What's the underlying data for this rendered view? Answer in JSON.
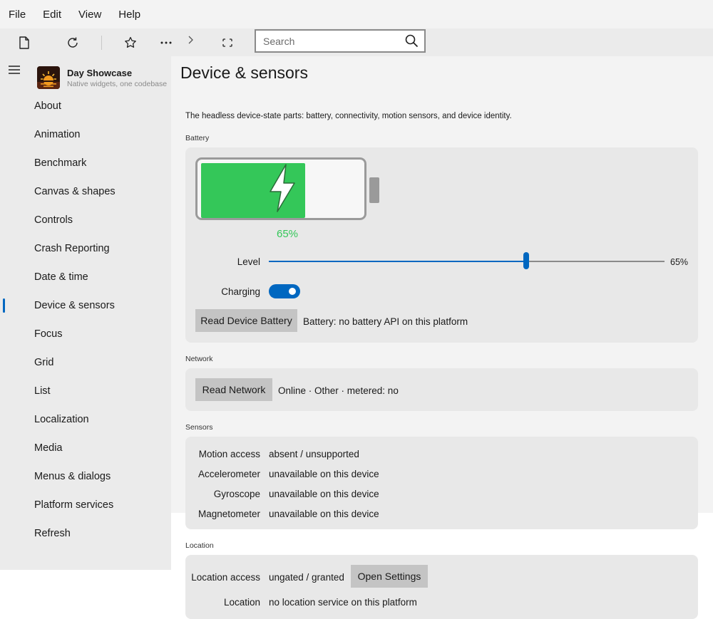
{
  "menu": [
    "File",
    "Edit",
    "View",
    "Help"
  ],
  "toolbar": {
    "search_placeholder": "Search"
  },
  "app": {
    "name": "Day Showcase",
    "subtitle": "Native widgets, one codebase"
  },
  "sidebar": {
    "items": [
      {
        "label": "About"
      },
      {
        "label": "Animation"
      },
      {
        "label": "Benchmark"
      },
      {
        "label": "Canvas & shapes"
      },
      {
        "label": "Controls"
      },
      {
        "label": "Crash Reporting"
      },
      {
        "label": "Date & time"
      },
      {
        "label": "Device & sensors",
        "active": true
      },
      {
        "label": "Focus"
      },
      {
        "label": "Grid"
      },
      {
        "label": "List"
      },
      {
        "label": "Localization"
      },
      {
        "label": "Media"
      },
      {
        "label": "Menus & dialogs"
      },
      {
        "label": "Platform services"
      },
      {
        "label": "Refresh"
      }
    ]
  },
  "page": {
    "title": "Device & sensors",
    "description": "The headless device-state parts: battery, connectivity, motion sensors, and device identity."
  },
  "battery": {
    "section_label": "Battery",
    "level": 65,
    "level_text": "65%",
    "level_label": "Level",
    "slider_value_text": "65%",
    "charging_label": "Charging",
    "charging": true,
    "read_button": "Read Device Battery",
    "status": "Battery: no battery API on this platform",
    "fill_color": "#34c759"
  },
  "network": {
    "section_label": "Network",
    "read_button": "Read Network",
    "status": "Online · Other · metered: no"
  },
  "sensors": {
    "section_label": "Sensors",
    "rows": [
      {
        "label": "Motion access",
        "value": "absent / unsupported"
      },
      {
        "label": "Accelerometer",
        "value": "unavailable on this device"
      },
      {
        "label": "Gyroscope",
        "value": "unavailable on this device"
      },
      {
        "label": "Magnetometer",
        "value": "unavailable on this device"
      }
    ]
  },
  "location": {
    "section_label": "Location",
    "access_label": "Location access",
    "access_value": "ungated / granted",
    "settings_button": "Open Settings",
    "location_label": "Location",
    "location_value": "no location service on this platform"
  },
  "colors": {
    "accent": "#0067c0",
    "battery_green": "#34c759"
  }
}
